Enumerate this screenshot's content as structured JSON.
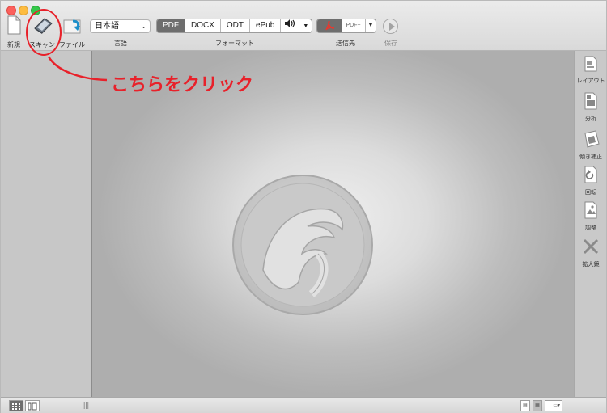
{
  "toolbar": {
    "new_label": "新規",
    "scan_label": "スキャン",
    "file_label": "ファイル",
    "language": {
      "selected": "日本語",
      "group_label": "言語"
    },
    "format": {
      "group_label": "フォーマット",
      "options": [
        "PDF",
        "DOCX",
        "ODT",
        "ePub"
      ],
      "active": "PDF",
      "audio_icon": "speaker-icon"
    },
    "destination": {
      "group_label": "送信先",
      "pdfplus": "PDF+"
    },
    "save_label": "保存"
  },
  "right_tools": [
    {
      "label": "レイアウト",
      "icon": "layout-icon"
    },
    {
      "label": "分析",
      "icon": "analyze-icon"
    },
    {
      "label": "傾き補正",
      "icon": "deskew-icon"
    },
    {
      "label": "回転",
      "icon": "rotate-icon"
    },
    {
      "label": "調整",
      "icon": "adjust-icon"
    },
    {
      "label": "拡大鏡",
      "icon": "magnifier-icon"
    }
  ],
  "annotation": {
    "text": "こちらをクリック",
    "color": "#e8212a"
  },
  "colors": {
    "accent": "#6e6e6e",
    "annotation": "#e8212a"
  }
}
